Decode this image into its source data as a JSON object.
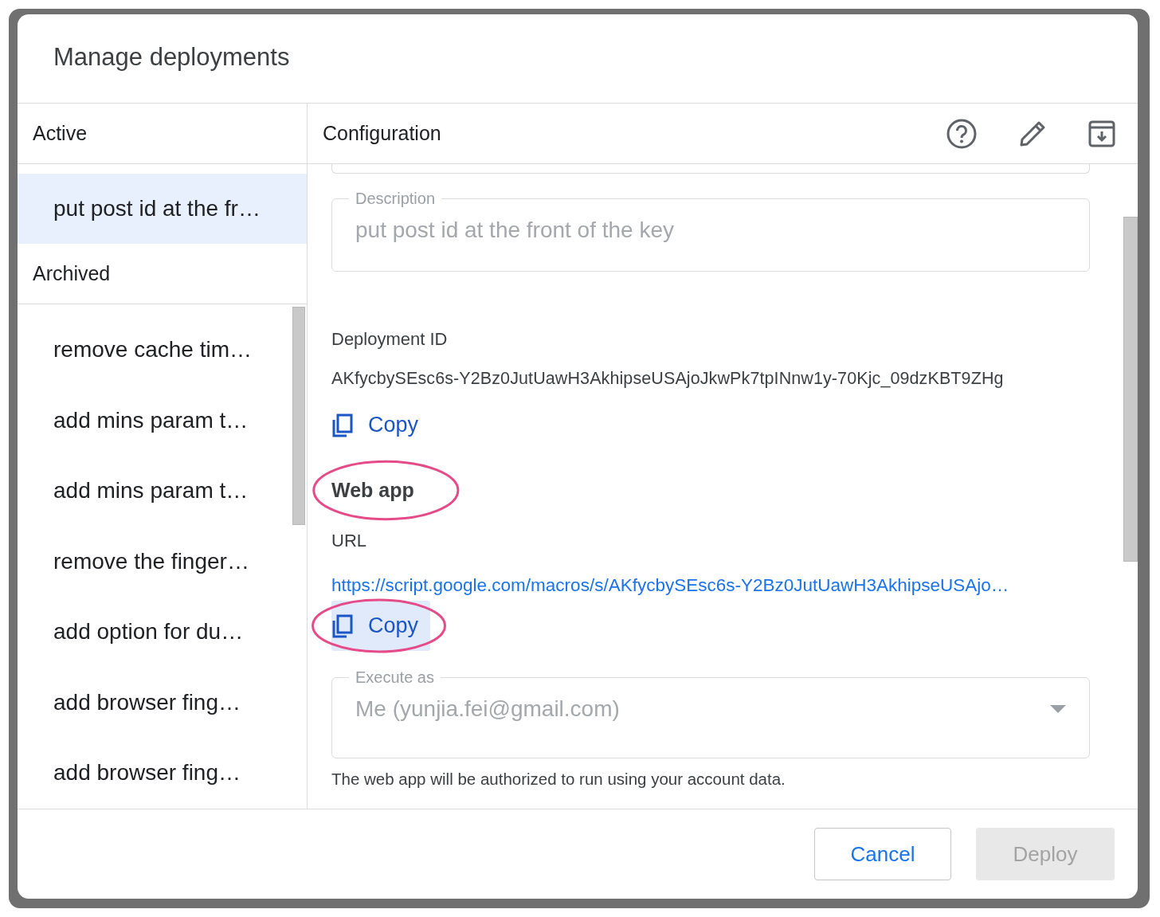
{
  "dialog": {
    "title": "Manage deployments"
  },
  "sidebar": {
    "active_heading": "Active",
    "active_items": [
      {
        "label": "put post id at the fr…",
        "selected": true
      }
    ],
    "archived_heading": "Archived",
    "archived_items": [
      {
        "label": "remove cache tim…",
        "selected": false
      },
      {
        "label": "add mins param t…",
        "selected": false
      },
      {
        "label": "add mins param t…",
        "selected": false
      },
      {
        "label": "remove the finger…",
        "selected": false
      },
      {
        "label": "add option for du…",
        "selected": false
      },
      {
        "label": "add browser fing…",
        "selected": false
      },
      {
        "label": "add browser fing…",
        "selected": false
      }
    ]
  },
  "configuration": {
    "heading": "Configuration",
    "description": {
      "label": "Description",
      "value": "put post id at the front of the key",
      "disabled": true
    },
    "deployment_id": {
      "label": "Deployment ID",
      "value": "AKfycbySEsc6s-Y2Bz0JutUawH3AkhipseUSAjoJkwPk7tpINnw1y-70Kjc_09dzKBT9ZHg",
      "copy_button": {
        "label": "Copy",
        "focused": false,
        "circled": false
      }
    },
    "web_app": {
      "heading": "Web app",
      "circled": true,
      "url_label": "URL",
      "url": "https://script.google.com/macros/s/AKfycbySEsc6s-Y2Bz0JutUawH3AkhipseUSAjo…",
      "copy_button": {
        "label": "Copy",
        "focused": true,
        "circled": true
      },
      "execute_as": {
        "label": "Execute as",
        "value": "Me (yunjia.fei@gmail.com)",
        "disabled": true
      },
      "helper": "The web app will be authorized to run using your account data."
    }
  },
  "buttons": [
    {
      "label": "Cancel",
      "kind": "secondary",
      "disabled": false
    },
    {
      "label": "Deploy",
      "kind": "primary",
      "disabled": true
    }
  ]
}
